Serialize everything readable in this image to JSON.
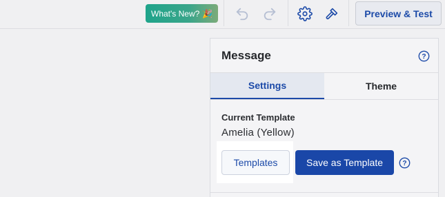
{
  "topbar": {
    "whats_new_label": "What's New?",
    "whats_new_icon": "party-popper-icon",
    "preview_label": "Preview & Test"
  },
  "panel": {
    "title": "Message",
    "tabs": [
      {
        "label": "Settings",
        "active": true
      },
      {
        "label": "Theme",
        "active": false
      }
    ],
    "current_template_label": "Current Template",
    "current_template_value": "Amelia (Yellow)",
    "templates_button": "Templates",
    "save_template_button": "Save as Template"
  },
  "colors": {
    "accent": "#1c4aa8",
    "primary_button": "#1a47a8",
    "whats_new_gradient_start": "#1fa48b"
  }
}
